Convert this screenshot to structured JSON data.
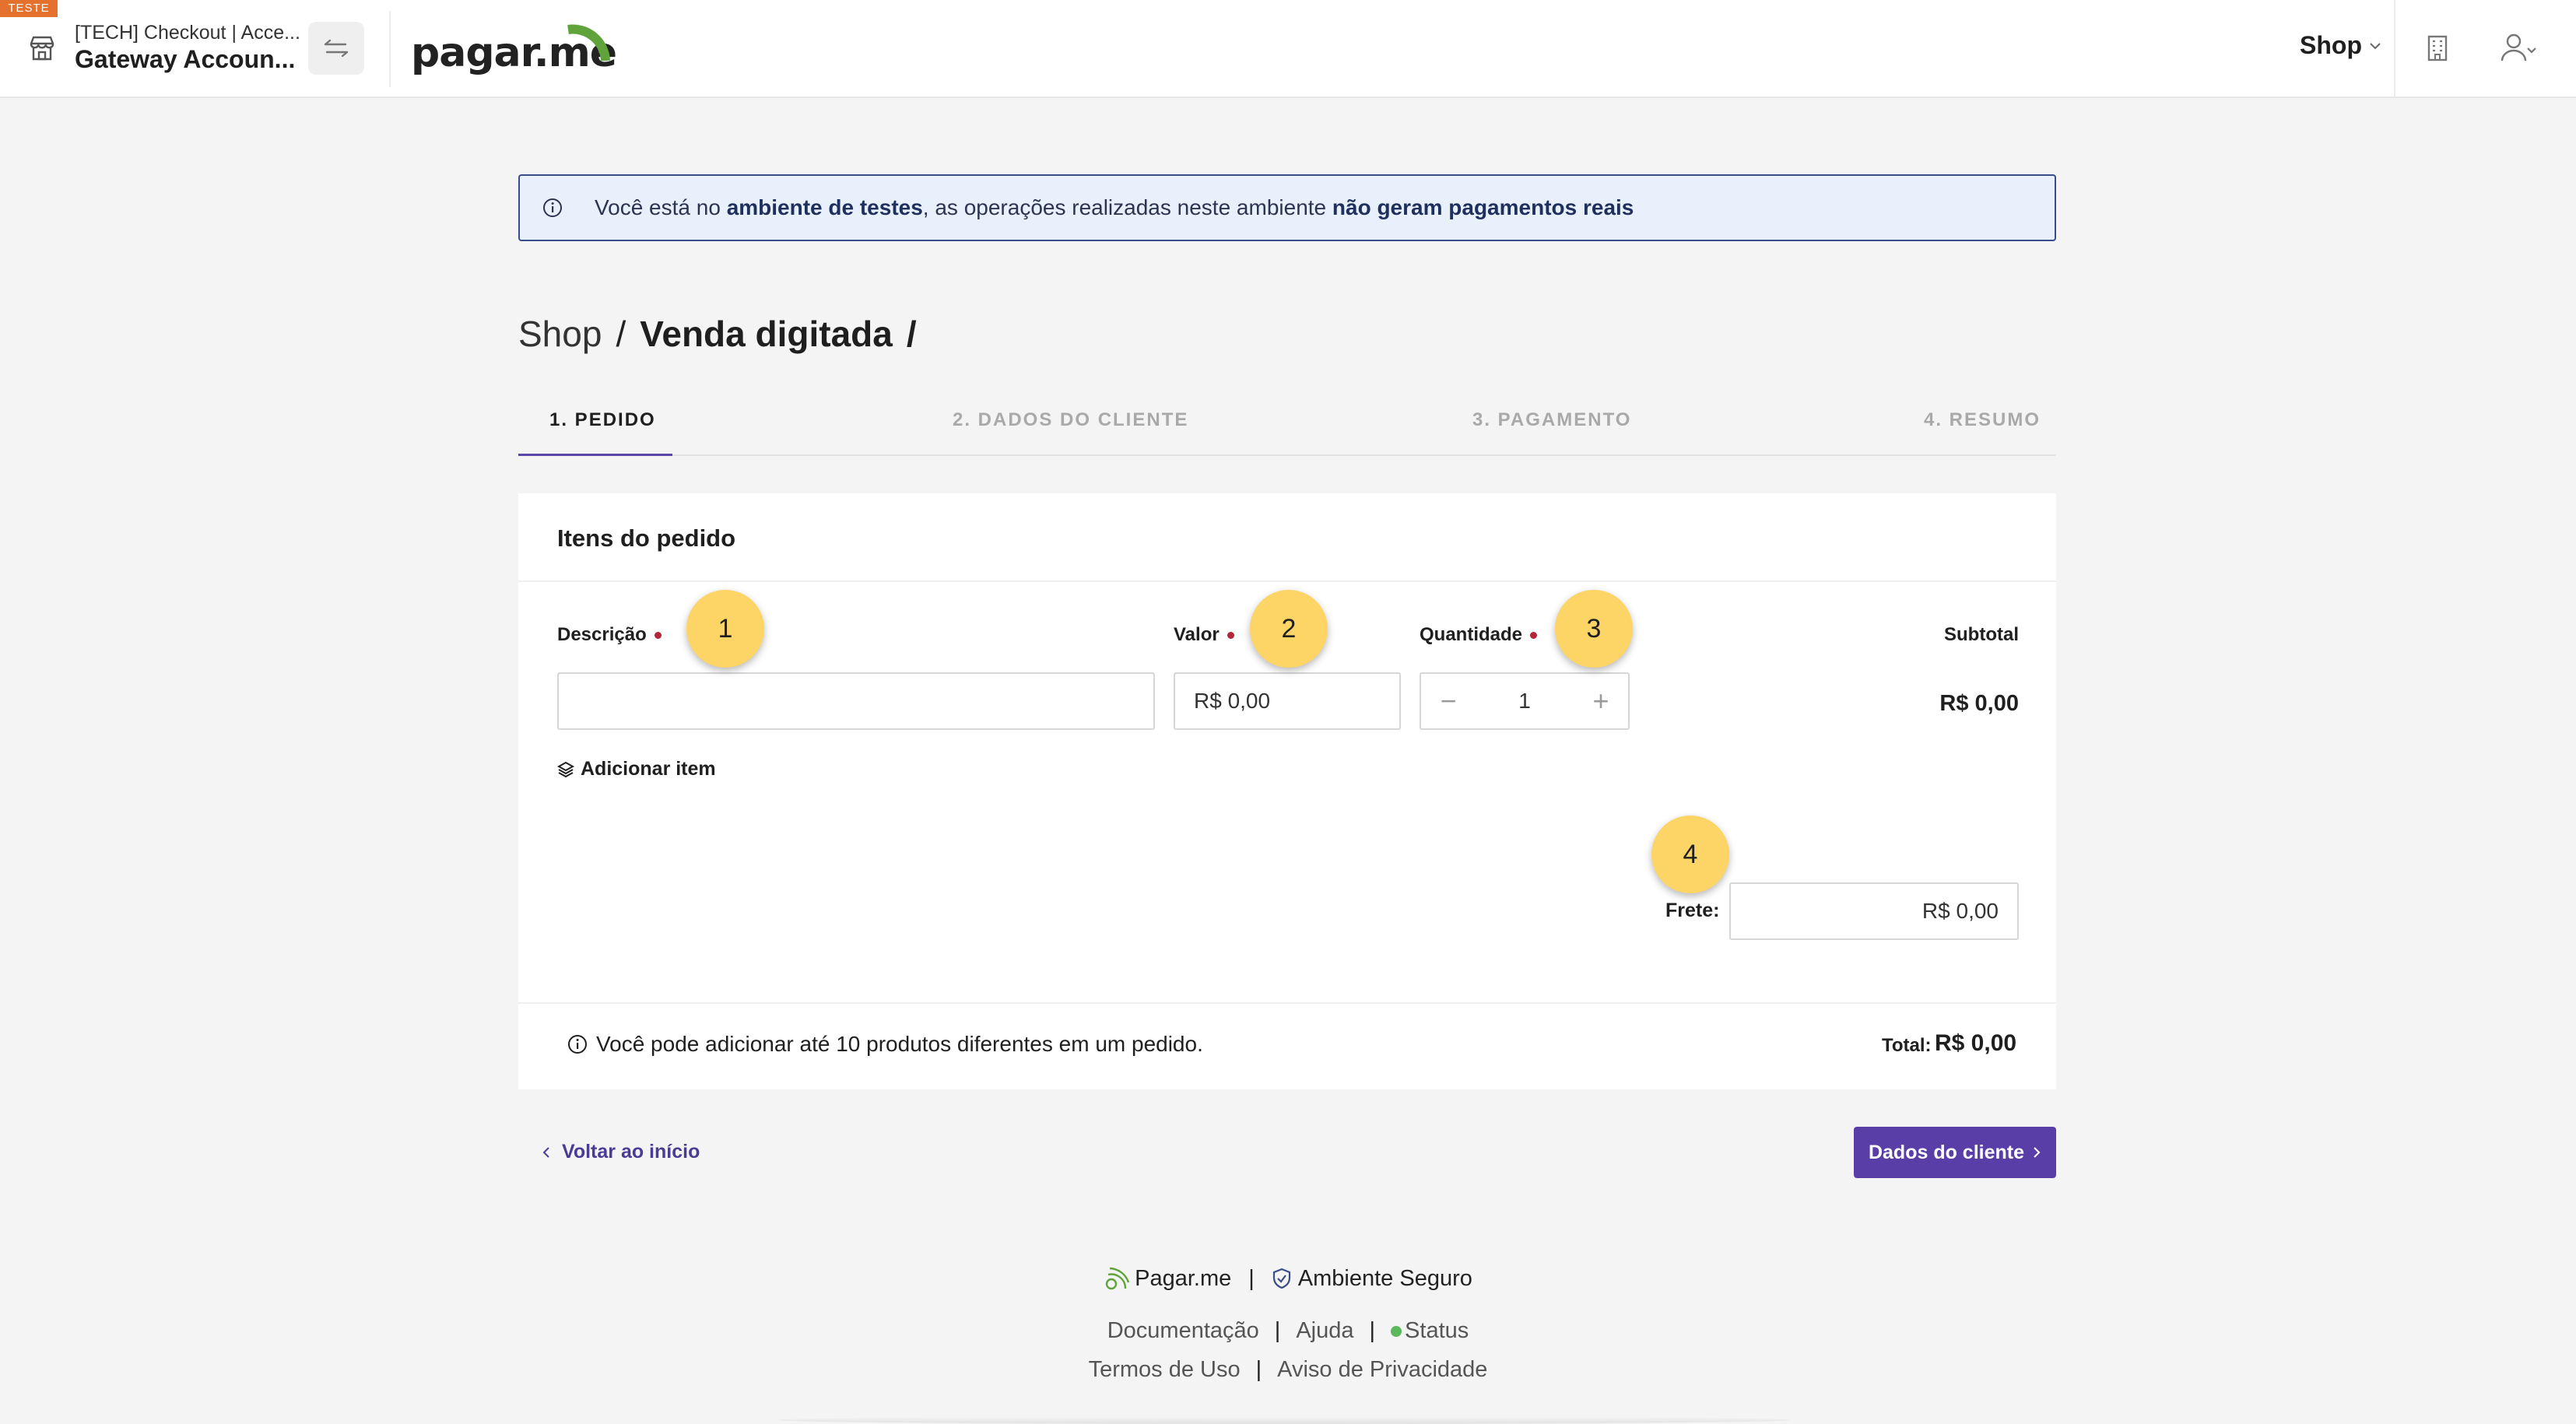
{
  "header": {
    "env_badge": "TESTE",
    "account_subtitle": "[TECH] Checkout | Acce...",
    "account_name": "Gateway Accoun...",
    "brand": "pagar.me",
    "shop_menu": "Shop"
  },
  "banner": {
    "prefix": "Você está no ",
    "bold1": "ambiente de testes",
    "middle": ", as operações realizadas neste ambiente ",
    "bold2": "não geram pagamentos reais"
  },
  "breadcrumb": {
    "root": "Shop",
    "separator": "/",
    "current": "Venda digitada",
    "trailing": "/"
  },
  "steps": [
    {
      "label": "1. PEDIDO",
      "active": true
    },
    {
      "label": "2. DADOS DO CLIENTE",
      "active": false
    },
    {
      "label": "3. PAGAMENTO",
      "active": false
    },
    {
      "label": "4. RESUMO",
      "active": false
    }
  ],
  "order": {
    "title": "Itens do pedido",
    "description_label": "Descrição",
    "description_value": "",
    "valor_label": "Valor",
    "valor_value": "R$ 0,00",
    "quantidade_label": "Quantidade",
    "quantidade_value": "1",
    "minus": "−",
    "plus": "+",
    "subtotal_label": "Subtotal",
    "subtotal_value": "R$ 0,00",
    "add_item": "Adicionar item",
    "frete_label": "Frete:",
    "frete_value": "R$ 0,00",
    "note": "Você pode adicionar até 10 produtos diferentes em um pedido.",
    "total_label": "Total:",
    "total_value": "R$ 0,00"
  },
  "markers": [
    "1",
    "2",
    "3",
    "4"
  ],
  "nav": {
    "back": "Voltar ao início",
    "next": "Dados do cliente"
  },
  "footer": {
    "brand": "Pagar.me",
    "secure": "Ambiente Seguro",
    "pipe": "|",
    "docs": "Documentação",
    "help": "Ajuda",
    "status": "Status",
    "terms": "Termos de Uso",
    "privacy": "Aviso de Privacidade"
  },
  "colors": {
    "accent": "#5a3ea8",
    "brand_green": "#5fa33a",
    "marker": "#fcd566",
    "badge": "#e5712f",
    "required": "#b3263a"
  }
}
